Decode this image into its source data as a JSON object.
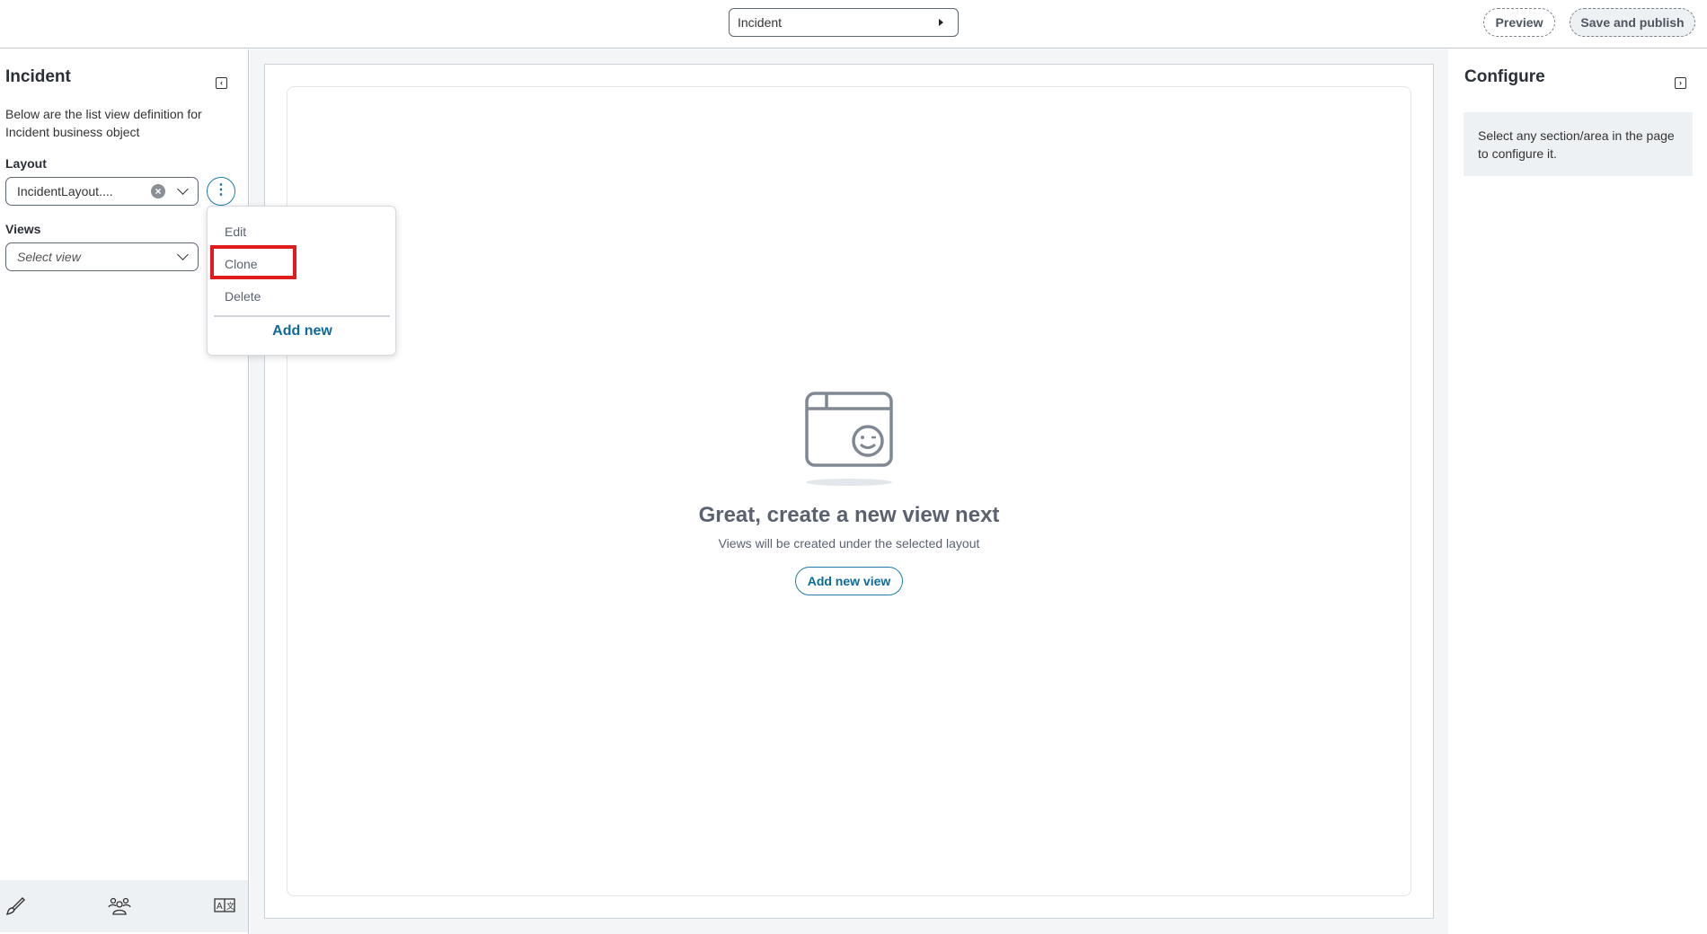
{
  "topbar": {
    "object": "Incident",
    "preview": "Preview",
    "publish": "Save and publish"
  },
  "left": {
    "title": "Incident",
    "description": "Below are the list view definition for Incident business object",
    "layout_label": "Layout",
    "layout_value": "IncidentLayout....",
    "views_label": "Views",
    "views_placeholder": "Select view",
    "kebab": "⋮"
  },
  "menu": {
    "items": [
      "Edit",
      "Clone",
      "Delete"
    ],
    "add_new": "Add new",
    "highlighted": "Clone"
  },
  "main": {
    "title": "Great, create a new view next",
    "subtitle": "Views will be created under the selected layout",
    "button": "Add new view"
  },
  "right": {
    "title": "Configure",
    "info": "Select any section/area in the page to configure it."
  },
  "bottom_icons": [
    "brush-icon",
    "users-icon",
    "translate-icon"
  ],
  "colors": {
    "accent": "#0e6a96",
    "highlight": "#e01b1b"
  }
}
